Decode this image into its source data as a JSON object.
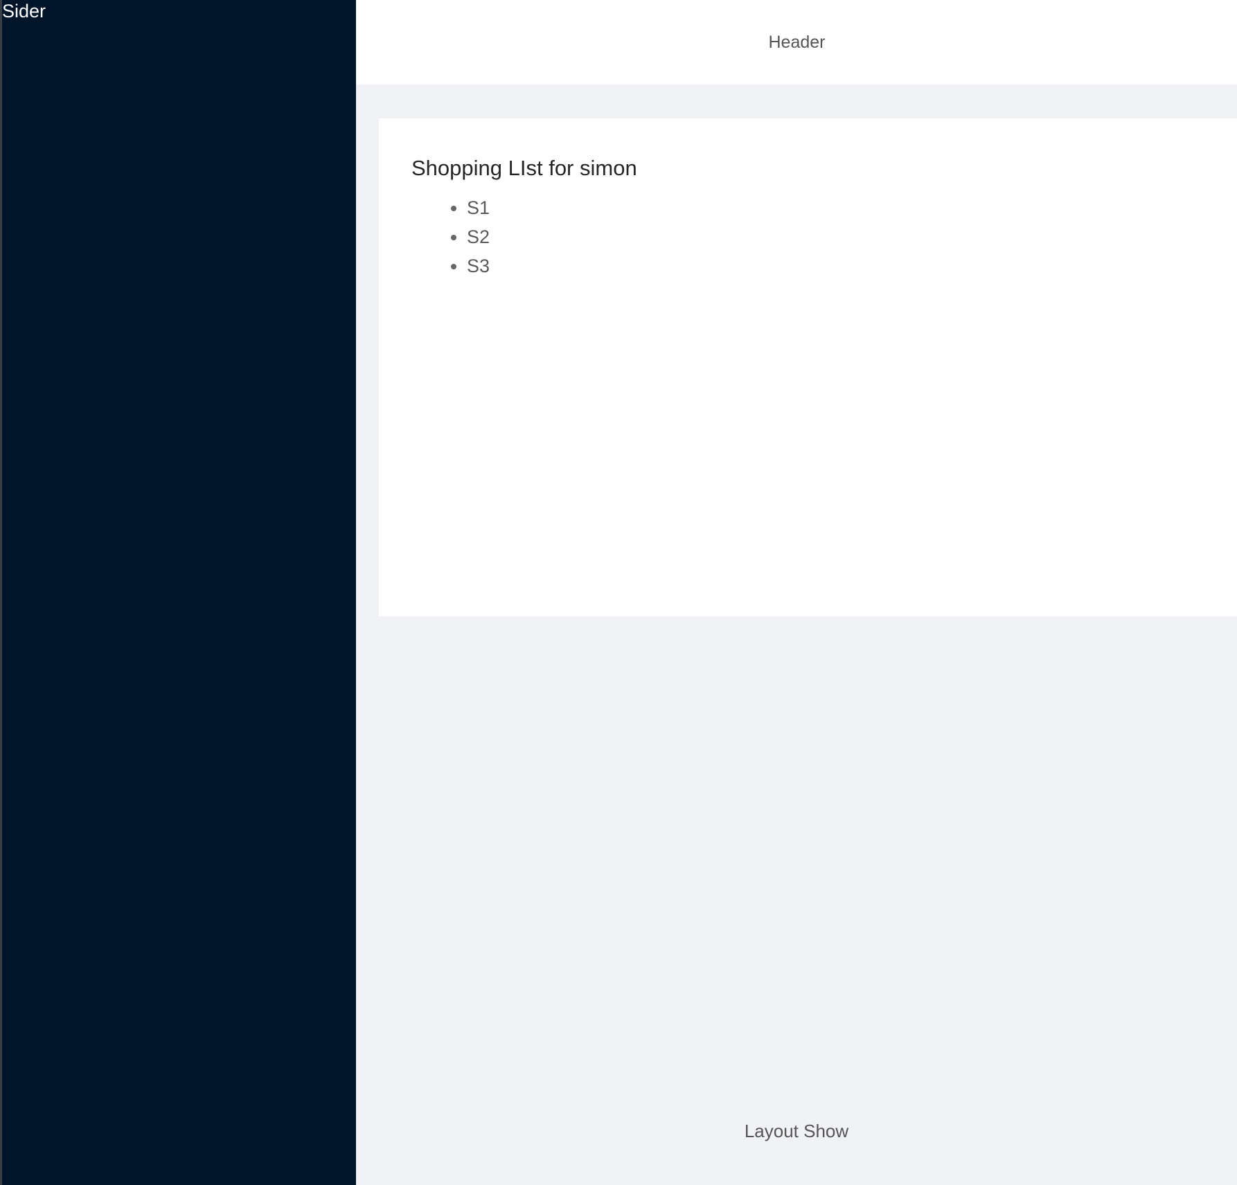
{
  "sider": {
    "label": "Sider"
  },
  "header": {
    "label": "Header"
  },
  "content": {
    "title": "Shopping LIst for simon",
    "items": [
      "S1",
      "S2",
      "S3"
    ]
  },
  "footer": {
    "label": "Layout Show"
  },
  "colors": {
    "sider_bg": "#001529",
    "layout_bg": "#f0f2f5"
  }
}
